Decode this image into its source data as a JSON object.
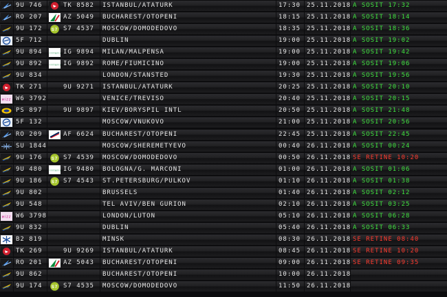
{
  "flights": [
    {
      "logo": "tarom-icon",
      "code": "9U 746",
      "logo2": "turkish-airlines-icon",
      "code2": "TK 8582",
      "dest": "ISTANBUL/ATATURK",
      "time": "17:30",
      "date": "25.11.2018",
      "status": "A SOSIT 17:32",
      "status_color": "#3fe03f"
    },
    {
      "logo": "tarom-icon",
      "code": "RO 207",
      "logo2": "alitalia-icon",
      "code2": "AZ 5049",
      "dest": "BUCHAREST/OTOPENI",
      "time": "18:15",
      "date": "25.11.2018",
      "status": "A SOSIT 18:14",
      "status_color": "#3fe03f"
    },
    {
      "logo": "air-moldova-icon",
      "code": "9U 172",
      "logo2": "s7-airlines-icon",
      "code2": "S7 4537",
      "dest": "MOSCOW/DOMODEDOVO",
      "time": "18:35",
      "date": "25.11.2018",
      "status": "A SOSIT 18:36",
      "status_color": "#3fe03f"
    },
    {
      "logo": "fly-one-icon",
      "code": "5F 712",
      "logo2": "",
      "code2": "",
      "dest": "DUBLIN",
      "time": "19:00",
      "date": "25.11.2018",
      "status": "A SOSIT 19:02",
      "status_color": "#3fe03f"
    },
    {
      "logo": "air-moldova-icon",
      "code": "9U 894",
      "logo2": "alitalia-text-icon",
      "code2": "IG 9894",
      "dest": "MILAN/MALPENSA",
      "time": "19:00",
      "date": "25.11.2018",
      "status": "A SOSIT 19:42",
      "status_color": "#3fe03f"
    },
    {
      "logo": "air-moldova-icon",
      "code": "9U 892",
      "logo2": "alitalia-text-icon",
      "code2": "IG 9892",
      "dest": "ROME/FIUMICINO",
      "time": "19:00",
      "date": "25.11.2018",
      "status": "A SOSIT 19:06",
      "status_color": "#3fe03f"
    },
    {
      "logo": "air-moldova-icon",
      "code": "9U 834",
      "logo2": "",
      "code2": "",
      "dest": "LONDON/STANSTED",
      "time": "19:30",
      "date": "25.11.2018",
      "status": "A SOSIT 19:56",
      "status_color": "#3fe03f"
    },
    {
      "logo": "turkish-airlines-icon",
      "code": "TK 271",
      "logo2": "",
      "code2": "9U 9271",
      "dest": "ISTANBUL/ATATURK",
      "time": "20:25",
      "date": "25.11.2018",
      "status": "A SOSIT 20:10",
      "status_color": "#3fe03f"
    },
    {
      "logo": "wizz-air-icon",
      "code": "W6 3792",
      "logo2": "",
      "code2": "",
      "dest": "VENICE/TREVISO",
      "time": "20:40",
      "date": "25.11.2018",
      "status": "A SOSIT 20:15",
      "status_color": "#3fe03f"
    },
    {
      "logo": "ukraine-international-icon",
      "code": "PS 897",
      "logo2": "",
      "code2": "9U 9897",
      "dest": "KIEV/BORYSPIL INTL",
      "time": "20:50",
      "date": "25.11.2018",
      "status": "A SOSIT 21:48",
      "status_color": "#3fe03f"
    },
    {
      "logo": "fly-one-icon",
      "code": "5F 132",
      "logo2": "",
      "code2": "",
      "dest": "MOSCOW/VNUKOVO",
      "time": "21:00",
      "date": "25.11.2018",
      "status": "A SOSIT 20:56",
      "status_color": "#3fe03f"
    },
    {
      "logo": "tarom-icon",
      "code": "RO 209",
      "logo2": "air-france-icon",
      "code2": "AF 6624",
      "dest": "BUCHAREST/OTOPENI",
      "time": "22:45",
      "date": "25.11.2018",
      "status": "A SOSIT 22:45",
      "status_color": "#3fe03f"
    },
    {
      "logo": "aeroflot-icon",
      "code": "SU 1844",
      "logo2": "",
      "code2": "",
      "dest": "MOSCOW/SHEREMETYEVO",
      "time": "00:40",
      "date": "26.11.2018",
      "status": "A SOSIT 00:24",
      "status_color": "#3fe03f"
    },
    {
      "logo": "air-moldova-icon",
      "code": "9U 176",
      "logo2": "s7-airlines-icon",
      "code2": "S7 4539",
      "dest": "MOSCOW/DOMODEDOVO",
      "time": "00:50",
      "date": "26.11.2018",
      "status": "SE RETINE 10:20",
      "status_color": "#ff3b2f"
    },
    {
      "logo": "air-moldova-icon",
      "code": "9U 480",
      "logo2": "alitalia-text-icon",
      "code2": "IG 9480",
      "dest": "BOLOGNA/G. MARCONI",
      "time": "01:00",
      "date": "26.11.2018",
      "status": "A SOSIT 01:06",
      "status_color": "#3fe03f"
    },
    {
      "logo": "air-moldova-icon",
      "code": "9U 186",
      "logo2": "s7-airlines-icon",
      "code2": "S7 4543",
      "dest": "ST.PETERSBURG/PULKOV",
      "time": "01:10",
      "date": "26.11.2018",
      "status": "A SOSIT 01:38",
      "status_color": "#3fe03f"
    },
    {
      "logo": "air-moldova-icon",
      "code": "9U 802",
      "logo2": "",
      "code2": "",
      "dest": "BRUSSELS",
      "time": "01:40",
      "date": "26.11.2018",
      "status": "A SOSIT 02:12",
      "status_color": "#3fe03f"
    },
    {
      "logo": "air-moldova-icon",
      "code": "9U 548",
      "logo2": "",
      "code2": "",
      "dest": "TEL AVIV/BEN GURION",
      "time": "02:10",
      "date": "26.11.2018",
      "status": "A SOSIT 03:25",
      "status_color": "#3fe03f"
    },
    {
      "logo": "wizz-air-icon",
      "code": "W6 3798",
      "logo2": "",
      "code2": "",
      "dest": "LONDON/LUTON",
      "time": "05:10",
      "date": "26.11.2018",
      "status": "A SOSIT 06:28",
      "status_color": "#3fe03f"
    },
    {
      "logo": "air-moldova-icon",
      "code": "9U 832",
      "logo2": "",
      "code2": "",
      "dest": "DUBLIN",
      "time": "05:40",
      "date": "26.11.2018",
      "status": "A SOSIT 06:33",
      "status_color": "#3fe03f"
    },
    {
      "logo": "belavia-icon",
      "code": "B2 819",
      "logo2": "",
      "code2": "",
      "dest": "MINSK",
      "time": "08:30",
      "date": "26.11.2018",
      "status": "SE RETINE 08:40",
      "status_color": "#ff3b2f"
    },
    {
      "logo": "turkish-airlines-icon",
      "code": "TK 269",
      "logo2": "",
      "code2": "9U 9269",
      "dest": "ISTANBUL/ATATURK",
      "time": "08:45",
      "date": "26.11.2018",
      "status": "SE RETINE 10:20",
      "status_color": "#ff3b2f"
    },
    {
      "logo": "tarom-icon",
      "code": "RO 201",
      "logo2": "alitalia-icon",
      "code2": "AZ 5043",
      "dest": "BUCHAREST/OTOPENI",
      "time": "09:00",
      "date": "26.11.2018",
      "status": "SE RETINE 09:35",
      "status_color": "#ff3b2f"
    },
    {
      "logo": "air-moldova-icon",
      "code": "9U 862",
      "logo2": "",
      "code2": "",
      "dest": "BUCHAREST/OTOPENI",
      "time": "10:00",
      "date": "26.11.2018",
      "status": "",
      "status_color": "#3fe03f"
    },
    {
      "logo": "air-moldova-icon",
      "code": "9U 174",
      "logo2": "s7-airlines-icon",
      "code2": "S7 4535",
      "dest": "MOSCOW/DOMODEDOVO",
      "time": "11:50",
      "date": "26.11.2018",
      "status": "",
      "status_color": "#3fe03f"
    }
  ]
}
